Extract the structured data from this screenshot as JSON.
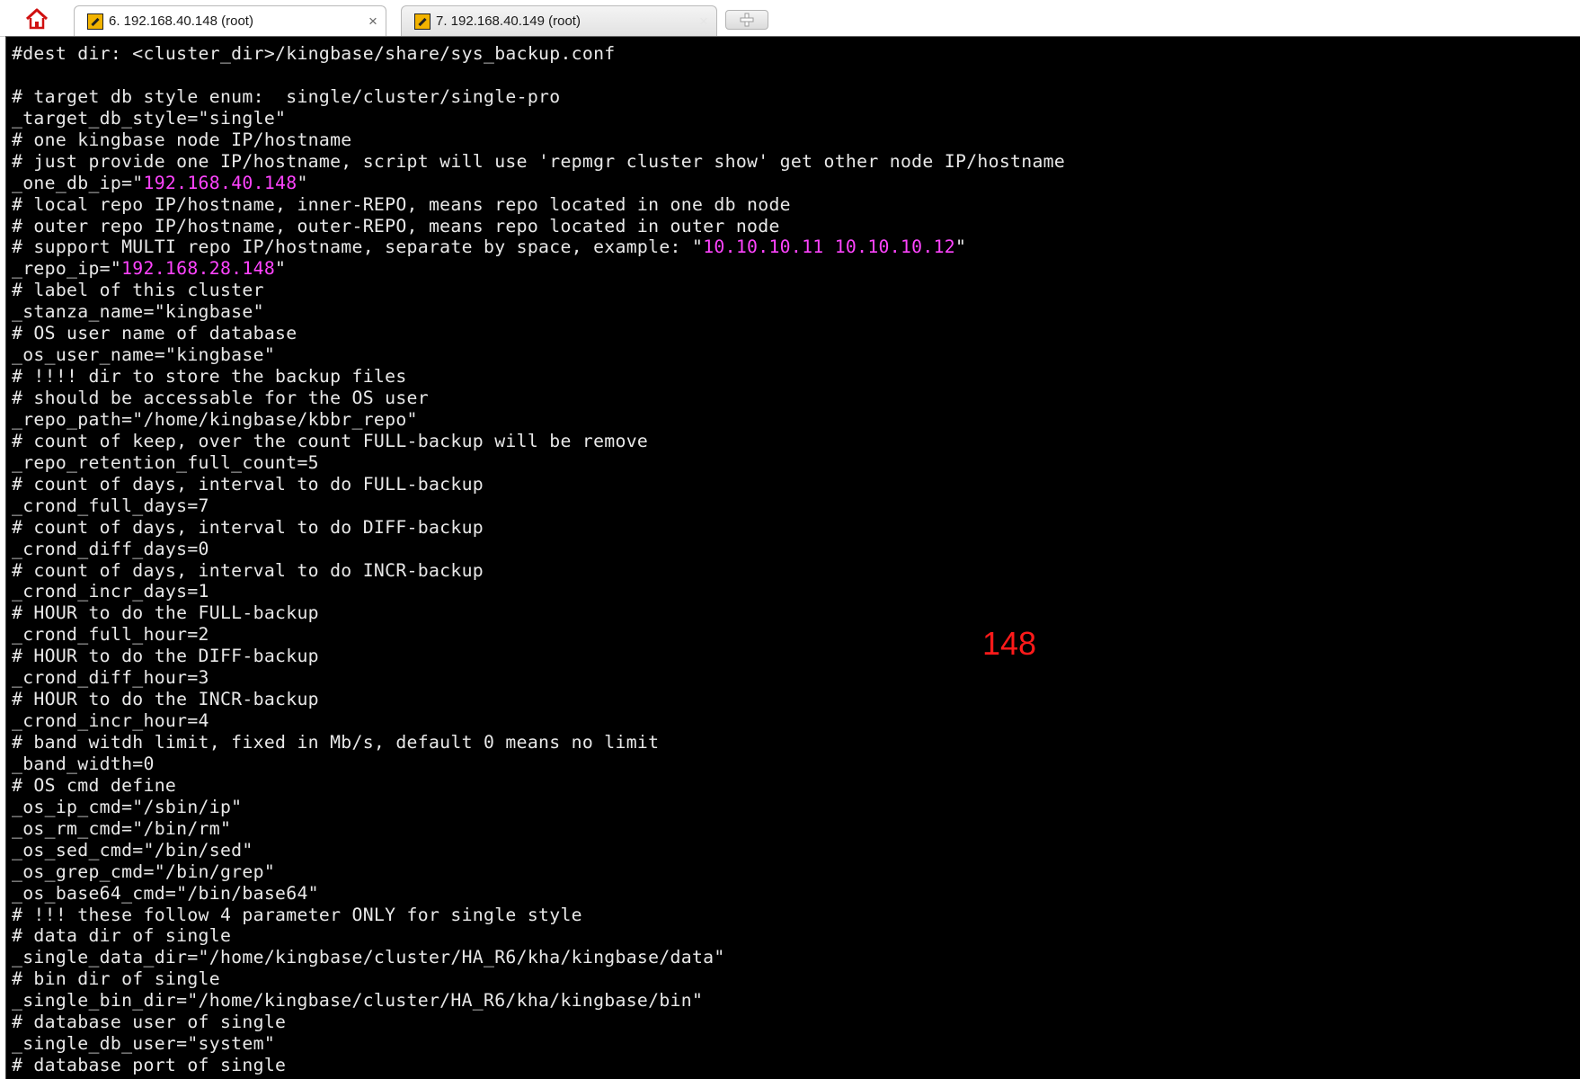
{
  "tabs": [
    {
      "label": "6. 192.168.40.148 (root)",
      "close": "×",
      "active": true
    },
    {
      "label": "7. 192.168.40.149 (root)",
      "close": "×",
      "active": false
    }
  ],
  "colors": {
    "terminal_bg": "#000000",
    "terminal_fg": "#e8e8e8",
    "highlight": "#ff44ff",
    "annotation": "#ff1a1a"
  },
  "icons": {
    "home": "home-icon",
    "tab": "terminal-session-icon",
    "new_tab": "plus-icon"
  },
  "terminal": {
    "lines": [
      [
        {
          "t": "#dest dir: <cluster_dir>/kingbase/share/sys_backup.conf"
        }
      ],
      [
        {
          "t": ""
        }
      ],
      [
        {
          "t": "# target db style enum:  single/cluster/single-pro"
        }
      ],
      [
        {
          "t": "_target_db_style=\"single\""
        }
      ],
      [
        {
          "t": "# one kingbase node IP/hostname"
        }
      ],
      [
        {
          "t": "# just provide one IP/hostname, script will use 'repmgr cluster show' get other node IP/hostname"
        }
      ],
      [
        {
          "t": "_one_db_ip=\""
        },
        {
          "t": "192.168.40.148",
          "hl": true
        },
        {
          "t": "\""
        }
      ],
      [
        {
          "t": "# local repo IP/hostname, inner-REPO, means repo located in one db node"
        }
      ],
      [
        {
          "t": "# outer repo IP/hostname, outer-REPO, means repo located in outer node"
        }
      ],
      [
        {
          "t": "# support MULTI repo IP/hostname, separate by space, example: \""
        },
        {
          "t": "10.10.10.11 10.10.10.12",
          "hl": true
        },
        {
          "t": "\""
        }
      ],
      [
        {
          "t": "_repo_ip=\""
        },
        {
          "t": "192.168.28.148",
          "hl": true
        },
        {
          "t": "\""
        }
      ],
      [
        {
          "t": "# label of this cluster"
        }
      ],
      [
        {
          "t": "_stanza_name=\"kingbase\""
        }
      ],
      [
        {
          "t": "# OS user name of database"
        }
      ],
      [
        {
          "t": "_os_user_name=\"kingbase\""
        }
      ],
      [
        {
          "t": "# !!!! dir to store the backup files"
        }
      ],
      [
        {
          "t": "# should be accessable for the OS user"
        }
      ],
      [
        {
          "t": "_repo_path=\"/home/kingbase/kbbr_repo\""
        }
      ],
      [
        {
          "t": "# count of keep, over the count FULL-backup will be remove"
        }
      ],
      [
        {
          "t": "_repo_retention_full_count=5"
        }
      ],
      [
        {
          "t": "# count of days, interval to do FULL-backup"
        }
      ],
      [
        {
          "t": "_crond_full_days=7"
        }
      ],
      [
        {
          "t": "# count of days, interval to do DIFF-backup"
        }
      ],
      [
        {
          "t": "_crond_diff_days=0"
        }
      ],
      [
        {
          "t": "# count of days, interval to do INCR-backup"
        }
      ],
      [
        {
          "t": "_crond_incr_days=1"
        }
      ],
      [
        {
          "t": "# HOUR to do the FULL-backup"
        }
      ],
      [
        {
          "t": "_crond_full_hour=2"
        }
      ],
      [
        {
          "t": "# HOUR to do the DIFF-backup"
        }
      ],
      [
        {
          "t": "_crond_diff_hour=3"
        }
      ],
      [
        {
          "t": "# HOUR to do the INCR-backup"
        }
      ],
      [
        {
          "t": "_crond_incr_hour=4"
        }
      ],
      [
        {
          "t": "# band witdh limit, fixed in Mb/s, default 0 means no limit"
        }
      ],
      [
        {
          "t": "_band_width=0"
        }
      ],
      [
        {
          "t": "# OS cmd define"
        }
      ],
      [
        {
          "t": "_os_ip_cmd=\"/sbin/ip\""
        }
      ],
      [
        {
          "t": "_os_rm_cmd=\"/bin/rm\""
        }
      ],
      [
        {
          "t": "_os_sed_cmd=\"/bin/sed\""
        }
      ],
      [
        {
          "t": "_os_grep_cmd=\"/bin/grep\""
        }
      ],
      [
        {
          "t": "_os_base64_cmd=\"/bin/base64\""
        }
      ],
      [
        {
          "t": "# !!! these follow 4 parameter ONLY for single style"
        }
      ],
      [
        {
          "t": "# data dir of single"
        }
      ],
      [
        {
          "t": "_single_data_dir=\"/home/kingbase/cluster/HA_R6/kha/kingbase/data\""
        }
      ],
      [
        {
          "t": "# bin dir of single"
        }
      ],
      [
        {
          "t": "_single_bin_dir=\"/home/kingbase/cluster/HA_R6/kha/kingbase/bin\""
        }
      ],
      [
        {
          "t": "# database user of single"
        }
      ],
      [
        {
          "t": "_single_db_user=\"system\""
        }
      ],
      [
        {
          "t": "# database port of single"
        }
      ]
    ]
  },
  "annotation": {
    "text": "148"
  }
}
